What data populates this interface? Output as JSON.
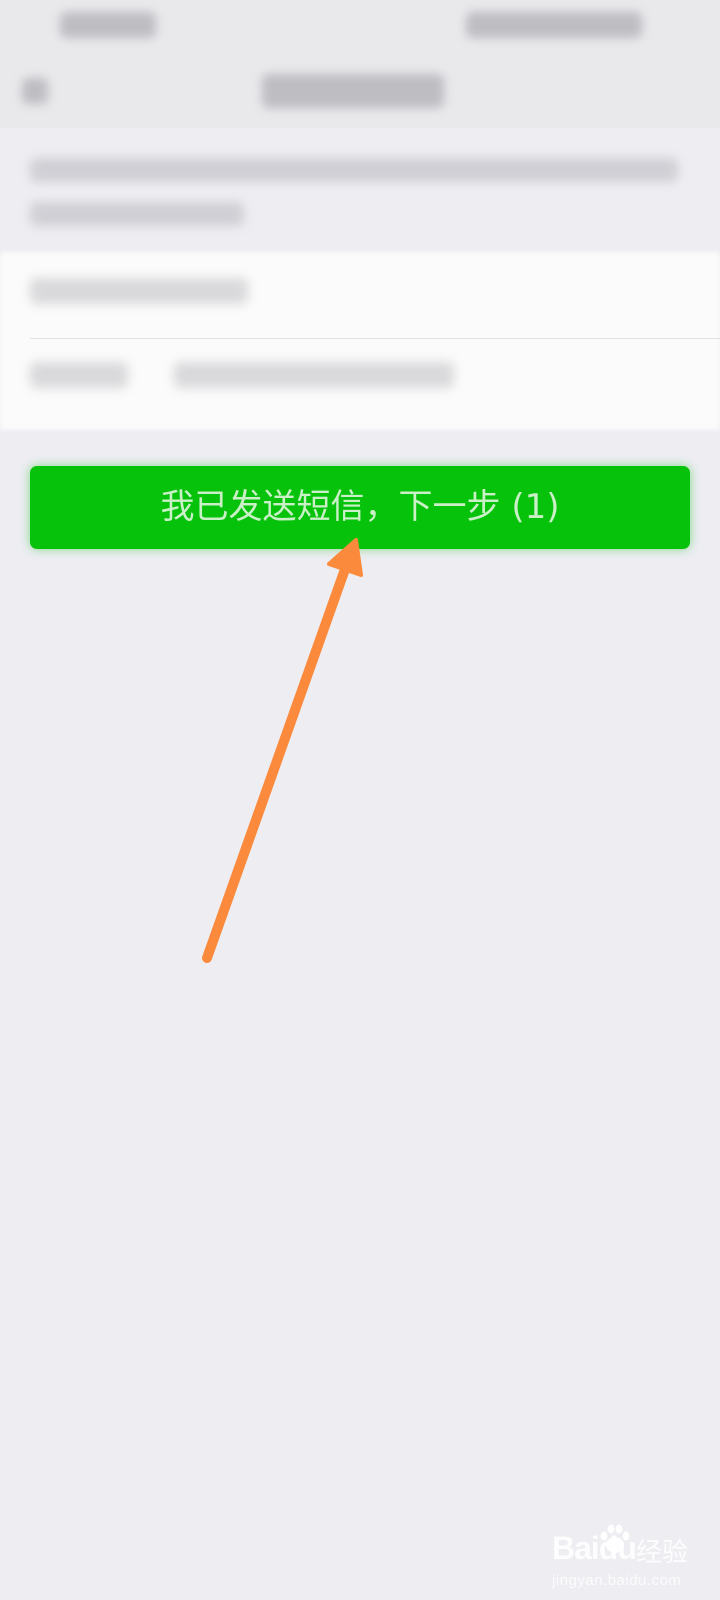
{
  "main": {
    "next_button_label": "我已发送短信，下一步 (1)"
  },
  "watermark": {
    "logo": "Baidu",
    "name": "经验",
    "domain": "jingyan.baidu.com"
  },
  "colors": {
    "primary_green": "#06c20b",
    "annotation_arrow": "#fb8a3c",
    "background": "#ededf2"
  }
}
